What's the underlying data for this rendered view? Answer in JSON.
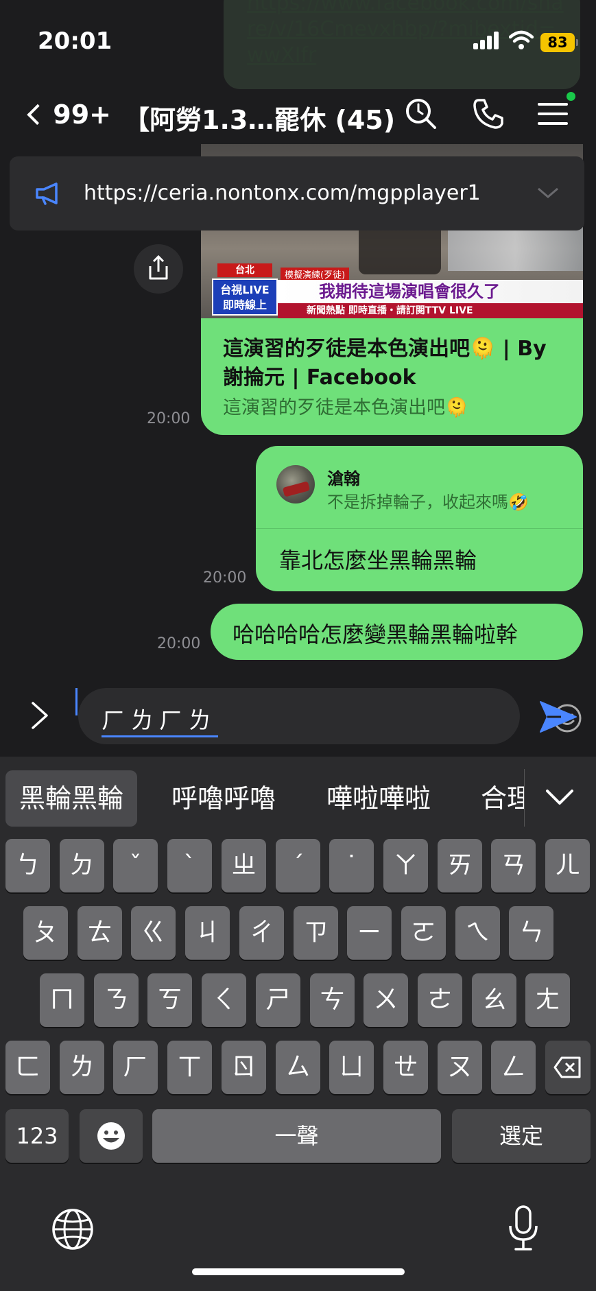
{
  "status": {
    "time": "20:01",
    "battery": "83"
  },
  "header": {
    "back_count": "99+",
    "title": "【阿勞1.3…罷休 (45)"
  },
  "background_bubble": {
    "text": "https://www.facebook.com/share/v/16Cmevxhbp/?mibextid=wwXIfr"
  },
  "announcement": {
    "text": "https://ceria.nontonx.com/mgpplayer1"
  },
  "link_card": {
    "news_location": "台北",
    "news_live": "台視LIVE 即時線上",
    "news_tag": "模擬演練(歹徒)",
    "news_headline": "我期待這場演唱會很久了",
    "news_ticker": "新聞熱點 即時直播・請訂閱TTV LIVE",
    "title": "這演習的歹徒是本色演出吧🫠 | By 謝掄元 | Facebook",
    "description": "這演習的歹徒是本色演出吧🫠",
    "time": "20:00"
  },
  "reply_message": {
    "quoted_name": "滄翰",
    "quoted_text": "不是拆掉輪子，收起來嗎🤣",
    "text": "靠北怎麼坐黑輪黑輪",
    "time": "20:00"
  },
  "last_message": {
    "text": "哈哈哈哈怎麼變黑輪黑輪啦幹",
    "time": "20:00"
  },
  "input": {
    "value": "ㄏㄌㄏㄌ"
  },
  "keyboard": {
    "candidates": [
      "黑輪黑輪",
      "呼嚕呼嚕",
      "嘩啦嘩啦",
      "合理"
    ],
    "row1": [
      "ㄅ",
      "ㄉ",
      "ˇ",
      "ˋ",
      "ㄓ",
      "ˊ",
      "˙",
      "ㄚ",
      "ㄞ",
      "ㄢ",
      "ㄦ"
    ],
    "row2": [
      "ㄆ",
      "ㄊ",
      "ㄍ",
      "ㄐ",
      "ㄔ",
      "ㄗ",
      "ㄧ",
      "ㄛ",
      "ㄟ",
      "ㄣ"
    ],
    "row3": [
      "ㄇ",
      "ㄋ",
      "ㄎ",
      "ㄑ",
      "ㄕ",
      "ㄘ",
      "ㄨ",
      "ㄜ",
      "ㄠ",
      "ㄤ"
    ],
    "row4": [
      "ㄈ",
      "ㄌ",
      "ㄏ",
      "ㄒ",
      "ㄖ",
      "ㄙ",
      "ㄩ",
      "ㄝ",
      "ㄡ",
      "ㄥ"
    ],
    "numbers_key": "123",
    "space_key": "一聲",
    "confirm_key": "選定"
  },
  "colors": {
    "bubble_green": "#6fe07a",
    "accent_blue": "#4a86ff",
    "battery_yellow": "#f5c400"
  }
}
